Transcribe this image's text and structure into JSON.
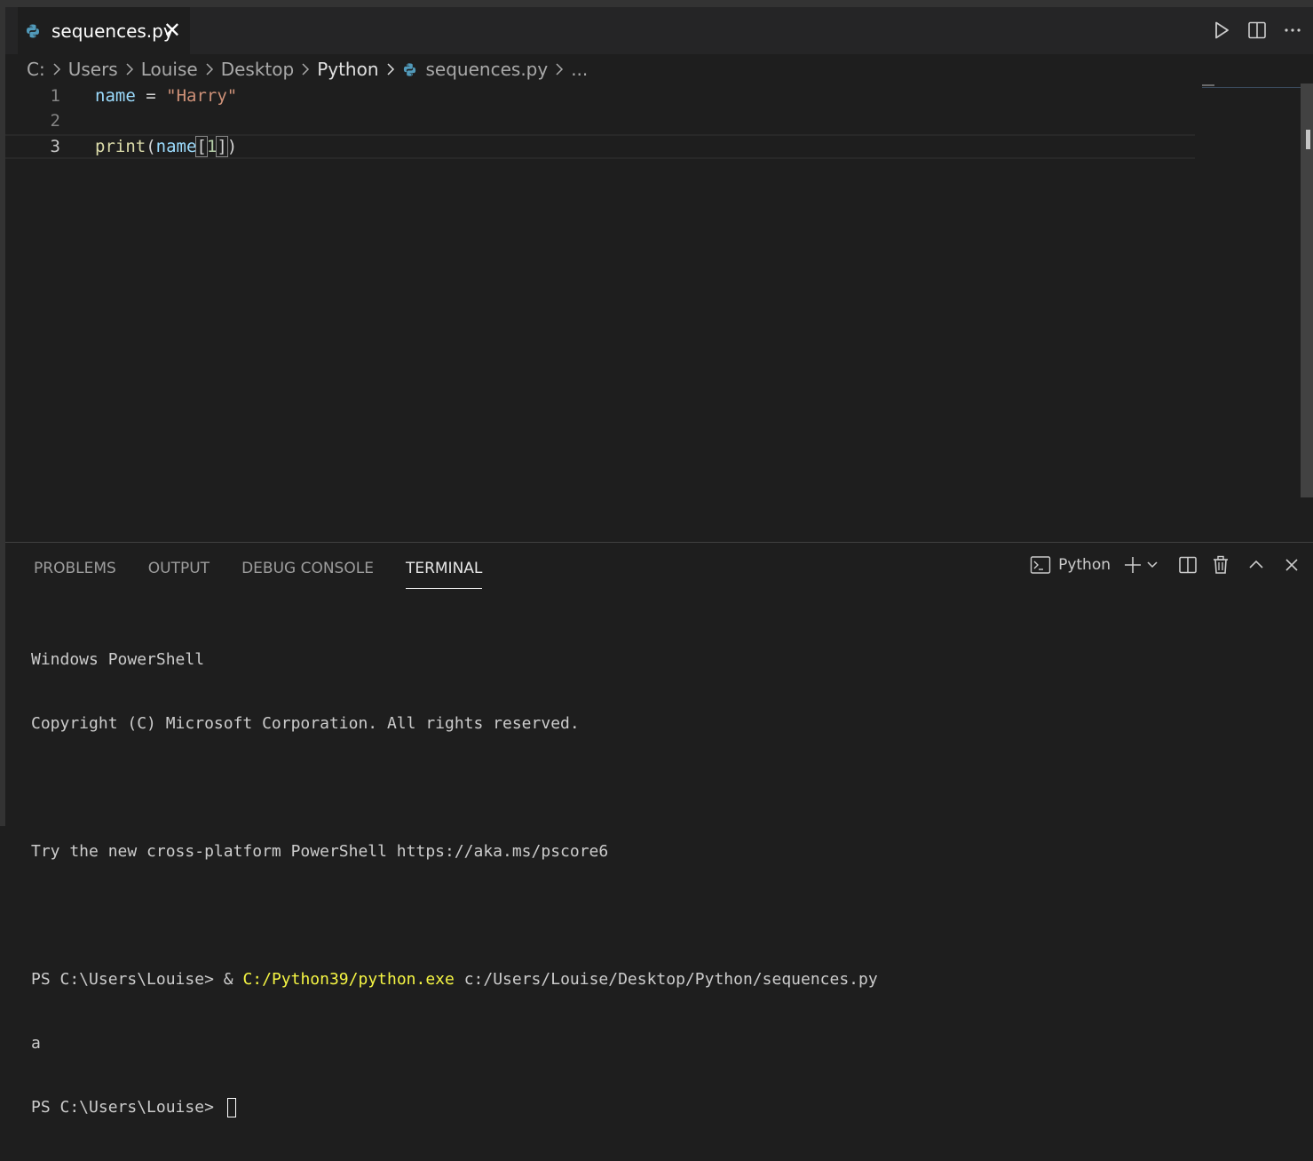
{
  "tab": {
    "title": "sequences.py",
    "close_label": "✕"
  },
  "breadcrumb": {
    "segments": [
      "C:",
      "Users",
      "Louise",
      "Desktop",
      "Python"
    ],
    "file": "sequences.py",
    "more": "..."
  },
  "editor": {
    "lines": [
      {
        "number": "1",
        "tokens": [
          "name",
          "=",
          "\"Harry\""
        ]
      },
      {
        "number": "2",
        "tokens": []
      },
      {
        "number": "3",
        "tokens": [
          "print",
          "(",
          "name",
          "[",
          "1",
          "]",
          ")"
        ]
      }
    ],
    "current_line": 3
  },
  "panel": {
    "tabs": [
      "PROBLEMS",
      "OUTPUT",
      "DEBUG CONSOLE",
      "TERMINAL"
    ],
    "active_tab": "TERMINAL",
    "terminal_selector": "Python"
  },
  "terminal": {
    "line1": "Windows PowerShell",
    "line2": "Copyright (C) Microsoft Corporation. All rights reserved.",
    "line4": "Try the new cross-platform PowerShell https://aka.ms/pscore6",
    "prompt": "PS C:\\Users\\Louise> ",
    "cmd_amp": "& ",
    "cmd_exe": "C:/Python39/python.exe",
    "cmd_arg": " c:/Users/Louise/Desktop/Python/sequences.py",
    "output": "a",
    "prompt2": "PS C:\\Users\\Louise> "
  },
  "colors": {
    "background": "#1e1e1e",
    "string": "#ce9178",
    "variable": "#9cdcfe",
    "function": "#dcdcaa",
    "number": "#b5cea8",
    "terminal_exe": "#f5f543"
  }
}
